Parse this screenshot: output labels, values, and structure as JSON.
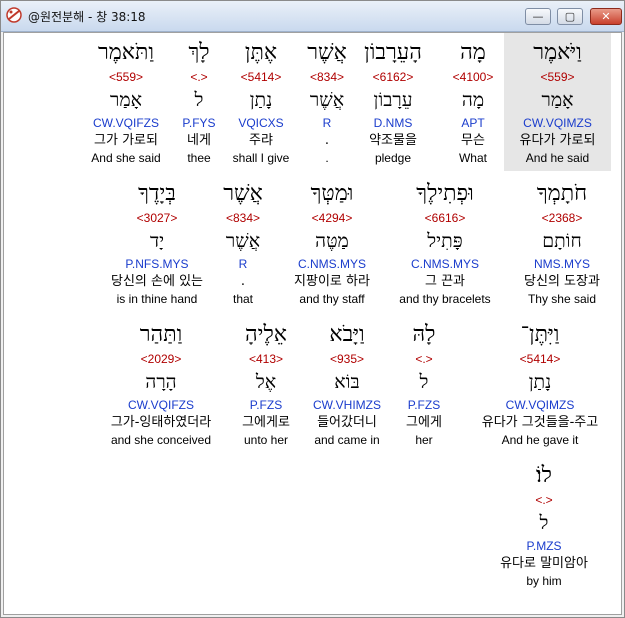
{
  "window": {
    "title": "@원전분해 - 창 38:18",
    "controls": {
      "minimize": "—",
      "maximize": "▢",
      "close": "✕"
    }
  },
  "words": [
    {
      "hebrew": "וַיֹּאמֶר",
      "strong": "<559>",
      "lemma": "אָמַר",
      "morph": "CW.VQIMZS",
      "korean": "유다가 가로되",
      "english": "And he said",
      "selected": true
    },
    {
      "hebrew": "מָה",
      "strong": "<4100>",
      "lemma": "מָה",
      "morph": "APT",
      "korean": "무슨",
      "english": "What"
    },
    {
      "hebrew": "הָעֵרָבוֹן",
      "strong": "<6162>",
      "lemma": "עֵרָבוֹן",
      "morph": "D.NMS",
      "korean": "약조물을",
      "english": "pledge"
    },
    {
      "hebrew": "אֲשֶׁר",
      "strong": "<834>",
      "lemma": "אֲשֶׁר",
      "morph": "R",
      "korean": ".",
      "english": "."
    },
    {
      "hebrew": "אֶתֶּן",
      "strong": "<5414>",
      "lemma": "נָתַן",
      "morph": "VQICXS",
      "korean": "주랴",
      "english": "shall I give"
    },
    {
      "hebrew": "לָךְ",
      "strong": "<.>",
      "lemma": "ל",
      "morph": "P.FYS",
      "korean": "네게",
      "english": "thee"
    },
    {
      "hebrew": "וַתֹּאמֶר",
      "strong": "<559>",
      "lemma": "אָמַר",
      "morph": "CW.VQIFZS",
      "korean": "그가 가로되",
      "english": "And she said"
    },
    {
      "hebrew": "חֹתָמְךָ",
      "strong": "<2368>",
      "lemma": "חוֹתָם",
      "morph": "NMS.MYS",
      "korean": "당신의 도장과",
      "english": "Thy she said"
    },
    {
      "hebrew": "וּפְתִילֶךָ",
      "strong": "<6616>",
      "lemma": "פָּתִיל",
      "morph": "C.NMS.MYS",
      "korean": "그 끈과",
      "english": "and thy bracelets"
    },
    {
      "hebrew": "וּמַטְּךָ",
      "strong": "<4294>",
      "lemma": "מַטֶּה",
      "morph": "C.NMS.MYS",
      "korean": "지팡이로 하라",
      "english": "and thy staff"
    },
    {
      "hebrew": "אֲשֶׁר",
      "strong": "<834>",
      "lemma": "אֲשֶׁר",
      "morph": "R",
      "korean": ".",
      "english": "that"
    },
    {
      "hebrew": "בְּיָדֶךָ",
      "strong": "<3027>",
      "lemma": "יָד",
      "morph": "P.NFS.MYS",
      "korean": "당신의 손에 있는",
      "english": "is in thine hand"
    },
    {
      "hebrew": "וַיִּתֶּן־",
      "strong": "<5414>",
      "lemma": "נָתַן",
      "morph": "CW.VQIMZS",
      "korean": "유다가 그것들을-주고",
      "english": "And he gave it"
    },
    {
      "hebrew": "לָהּ",
      "strong": "<.>",
      "lemma": "ל",
      "morph": "P.FZS",
      "korean": "그에게",
      "english": "her"
    },
    {
      "hebrew": "וַיָּבֹא",
      "strong": "<935>",
      "lemma": "בּוֹא",
      "morph": "CW.VHIMZS",
      "korean": "들어갔더니",
      "english": "and came in"
    },
    {
      "hebrew": "אֵלֶיהָ",
      "strong": "<413>",
      "lemma": "אֶל",
      "morph": "P.FZS",
      "korean": "그에게로",
      "english": "unto her"
    },
    {
      "hebrew": "וַתַּהַר",
      "strong": "<2029>",
      "lemma": "הָרָה",
      "morph": "CW.VQIFZS",
      "korean": "그가-잉태하였더라",
      "english": "and she conceived"
    },
    {
      "hebrew": "לוֹ׃",
      "strong": "<.>",
      "lemma": "ל",
      "morph": "P.MZS",
      "korean": "유다로 말미암아",
      "english": "by him"
    }
  ]
}
